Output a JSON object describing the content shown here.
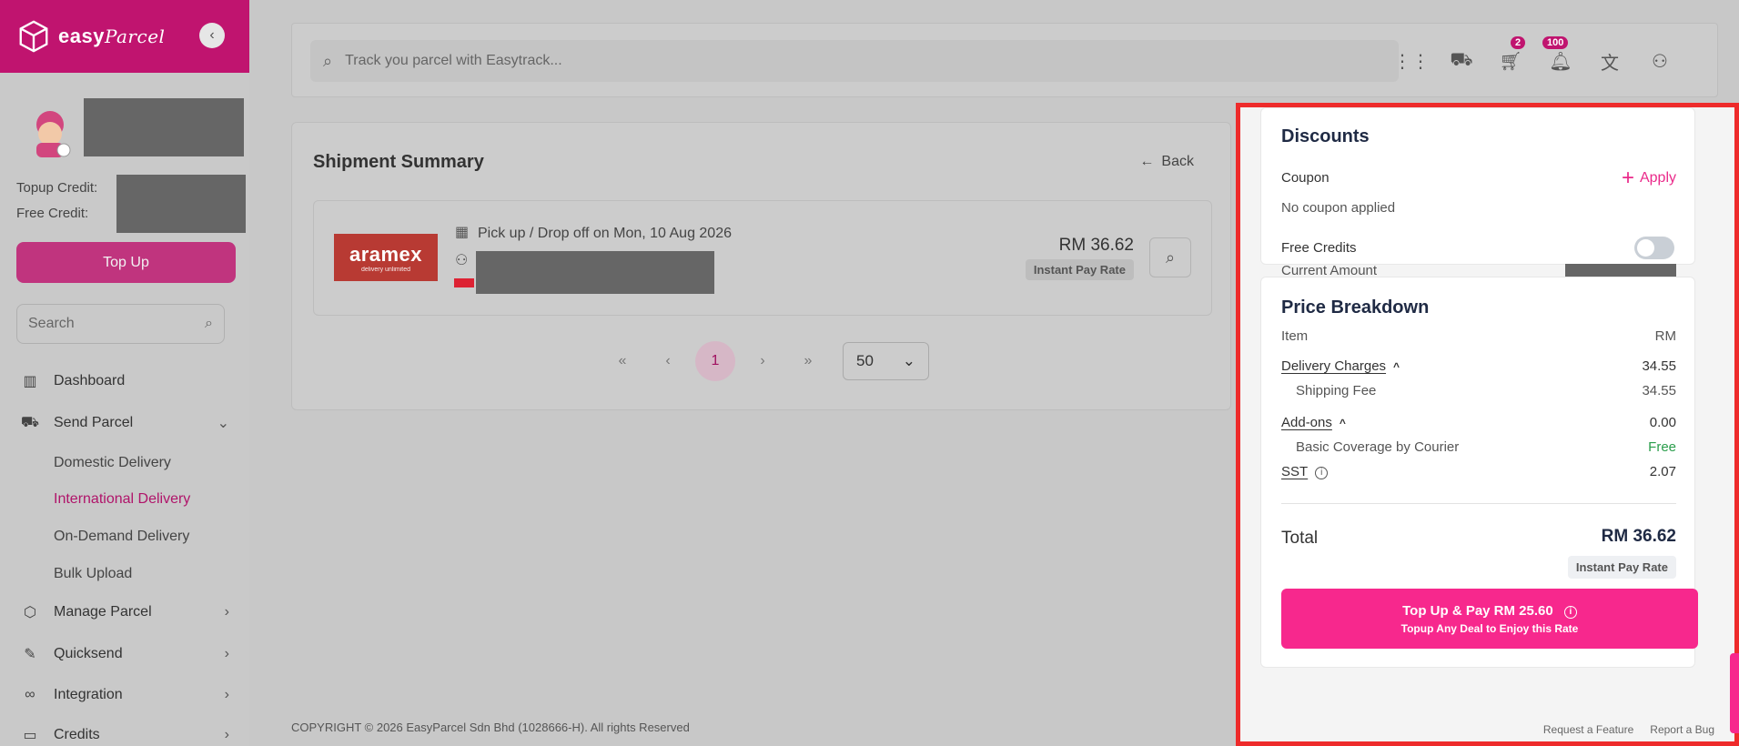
{
  "brand": {
    "name": "easy",
    "name_script": "Parcel"
  },
  "sidebar": {
    "credits": {
      "topup_label": "Topup Credit:",
      "free_label": "Free Credit:"
    },
    "topup_button": "Top Up",
    "search_placeholder": "Search",
    "nav": [
      {
        "label": "Dashboard",
        "icon": "chart-icon"
      },
      {
        "label": "Send Parcel",
        "icon": "truck-icon",
        "expanded": true,
        "children": [
          "Domestic Delivery",
          "International Delivery",
          "On-Demand Delivery",
          "Bulk Upload"
        ],
        "active_child": "International Delivery"
      },
      {
        "label": "Manage Parcel",
        "icon": "box-icon"
      },
      {
        "label": "Quicksend",
        "icon": "edit-icon"
      },
      {
        "label": "Integration",
        "icon": "link-icon"
      },
      {
        "label": "Credits",
        "icon": "wallet-icon"
      }
    ]
  },
  "topbar": {
    "track_placeholder": "Track you parcel with Easytrack...",
    "cart_count": "2",
    "notification_count": "100"
  },
  "summary": {
    "title": "Shipment Summary",
    "back_label": "Back",
    "shipment": {
      "courier": "aramex",
      "courier_tagline": "delivery unlimited",
      "pickup_text": "Pick up / Drop off on Mon, 10 Aug 2026",
      "price": "RM 36.62",
      "rate_badge": "Instant Pay Rate"
    },
    "pagination": {
      "current_page": "1",
      "per_page": "50"
    }
  },
  "copyright": "COPYRIGHT © 2026 EasyParcel Sdn Bhd (1028666-H). All rights Reserved",
  "discounts": {
    "title": "Discounts",
    "coupon_label": "Coupon",
    "apply_label": "Apply",
    "coupon_status": "No coupon applied",
    "free_credits_label": "Free Credits",
    "current_amount_label": "Current Amount",
    "free_credits_enabled": false
  },
  "breakdown": {
    "title": "Price Breakdown",
    "item_header": "Item",
    "currency_header": "RM",
    "delivery_charges_label": "Delivery Charges",
    "delivery_charges_value": "34.55",
    "shipping_fee_label": "Shipping Fee",
    "shipping_fee_value": "34.55",
    "addons_label": "Add-ons",
    "addons_value": "0.00",
    "coverage_label": "Basic Coverage by Courier",
    "coverage_value": "Free",
    "sst_label": "SST",
    "sst_value": "2.07",
    "total_label": "Total",
    "total_value": "RM 36.62",
    "rate_badge": "Instant Pay Rate",
    "pay_button": "Top Up & Pay RM 25.60",
    "pay_subtext": "Topup Any Deal to Enjoy this Rate",
    "footer_links": [
      "Request a Feature",
      "Report a Bug"
    ]
  },
  "colors": {
    "brand": "#c0146f",
    "accent": "#f7288d",
    "highlight": "#ee2b2b",
    "free": "#2a9d4b"
  }
}
